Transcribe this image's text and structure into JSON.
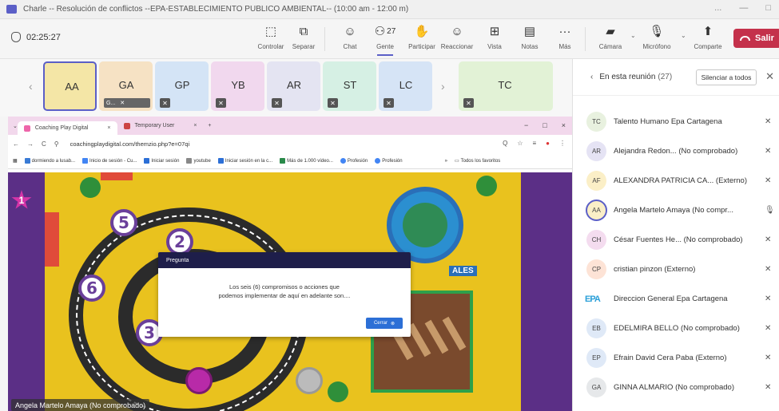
{
  "window": {
    "title": "Charle -- Resolución de conflictos --EPA-ESTABLECIMIENTO PUBLICO AMBIENTAL-- (10:00 am - 12:00 m)",
    "controls": [
      "...",
      "—",
      "□"
    ]
  },
  "toolbar": {
    "timer": "02:25:27",
    "tools": [
      {
        "label": "Controlar",
        "icon": "control-icon"
      },
      {
        "label": "Separar",
        "icon": "pop-out-icon"
      },
      {
        "label": "Chat",
        "icon": "chat-icon"
      },
      {
        "label": "Gente",
        "icon": "people-icon",
        "count": "27"
      },
      {
        "label": "Participar",
        "icon": "raise-hand-icon"
      },
      {
        "label": "Reaccionar",
        "icon": "react-icon"
      },
      {
        "label": "Vista",
        "icon": "view-icon"
      },
      {
        "label": "Notas",
        "icon": "notes-icon"
      },
      {
        "label": "Más",
        "icon": "more-icon"
      },
      {
        "label": "Cámara",
        "icon": "camera-off-icon"
      },
      {
        "label": "Micrófono",
        "icon": "mic-off-icon"
      },
      {
        "label": "Comparte",
        "icon": "share-icon"
      }
    ],
    "leave_label": "Salir"
  },
  "strip": {
    "tiles": [
      {
        "initials": "AA",
        "color": "#f4e6a6",
        "active": true
      },
      {
        "initials": "GA",
        "color": "#f6e2c4",
        "chip": "G..."
      },
      {
        "initials": "GP",
        "color": "#d4e4f6"
      },
      {
        "initials": "YB",
        "color": "#f1d8ee"
      },
      {
        "initials": "AR",
        "color": "#e4e4f2"
      },
      {
        "initials": "ST",
        "color": "#d6f0e4"
      },
      {
        "initials": "LC",
        "color": "#d6e4f6"
      },
      {
        "initials": "TC",
        "color": "#e2f2d6"
      }
    ]
  },
  "browser": {
    "tabs": [
      "Coaching Play Digital",
      "Temporary User"
    ],
    "tab_close": "×",
    "new_tab": "+",
    "window_controls": [
      "−",
      "□",
      "×"
    ],
    "nav": [
      "←",
      "→",
      "C"
    ],
    "url": "coachingplaydigital.com/themzio.php?e=07qi",
    "url_icons": [
      "Q",
      "☆",
      "≡",
      "●",
      "⋮"
    ],
    "bookmarks": [
      "dormiendo a lusab...",
      "Inicio de sesión - Cu...",
      "Iniciar sesión",
      "youtube",
      "Iniciar sesión en la c...",
      "Más de 1.000 vídeo...",
      "Profesión",
      "Profesión"
    ],
    "bookmarks_end": "Todos los favoritos"
  },
  "game": {
    "star_number": "1",
    "milestones": [
      "5",
      "2",
      "6",
      "3"
    ],
    "tag_text": "ALES",
    "dialog": {
      "title": "Pregunta",
      "text_line1": "Los seis (6) compromisos o acciones que",
      "text_line2": "podemos implementar de aquí en adelante son....",
      "button": "Cerrar"
    }
  },
  "video_name": "Angela Martelo Amaya (No comprobado)",
  "panel": {
    "title": "En esta reunión",
    "count": "(27)",
    "mute_all": "Silenciar a todos",
    "participants": [
      {
        "initials": "TC",
        "name": "Talento Humano Epa Cartagena",
        "color": "#e8f1df",
        "mic": "muted"
      },
      {
        "initials": "AR",
        "name": "Alejandra Redon... (No comprobado)",
        "color": "#e5e3f4",
        "mic": "muted"
      },
      {
        "initials": "AF",
        "name": "ALEXANDRA PATRICIA CA... (Externo)",
        "color": "#fbefc7",
        "mic": "muted"
      },
      {
        "initials": "AA",
        "name": "Angela Martelo Amaya (No compr...",
        "color": "#fbefc7",
        "mic": "on",
        "ring": true
      },
      {
        "initials": "CH",
        "name": "César Fuentes He... (No comprobado)",
        "color": "#f4dcef",
        "mic": "muted"
      },
      {
        "initials": "CP",
        "name": "cristian pinzon (Externo)",
        "color": "#fde3d6",
        "mic": "muted"
      },
      {
        "initials": "EPA",
        "name": "Direccion General Epa Cartagena",
        "logo": true,
        "mic": "muted"
      },
      {
        "initials": "EB",
        "name": "EDELMIRA BELLO (No comprobado)",
        "color": "#dfe9f7",
        "mic": "muted"
      },
      {
        "initials": "EP",
        "name": "Efrain David Cera Paba (Externo)",
        "color": "#dfe9f7",
        "mic": "muted"
      },
      {
        "initials": "GA",
        "name": "GINNA ALMARIO (No comprobado)",
        "color": "#e6e8ea",
        "mic": "muted"
      }
    ]
  },
  "colors": {
    "accent": "#5b5fc7",
    "leave": "#c4314b",
    "board": "#e9c21e",
    "purple": "#5b2f86"
  }
}
